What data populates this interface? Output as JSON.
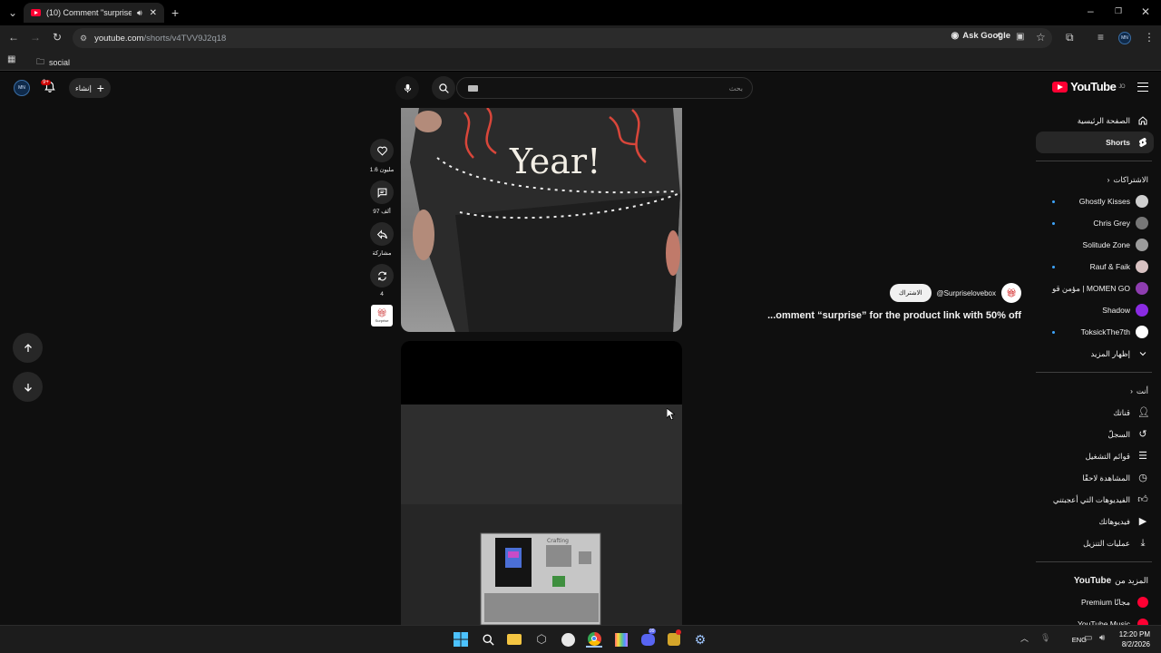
{
  "browser": {
    "tab_title": "(10) Comment \"surprise\" fo",
    "url_host": "youtube.com",
    "url_path": "/shorts/v4TVV9J2q18",
    "ask_google": "Ask Google",
    "bookmark_folder": "social",
    "profile_initials": "MN"
  },
  "masthead": {
    "logo_text": "YouTube",
    "logo_region": "JO",
    "search_placeholder": "بحث",
    "create_label": "إنشاء",
    "notif_count": "9+",
    "avatar_initials": "MN"
  },
  "sidebar": {
    "home": "الصفحة الرئيسية",
    "shorts": "Shorts",
    "subscriptions_header": "الاشتراكات",
    "subscriptions": [
      {
        "name": "Ghostly Kisses",
        "dot": true,
        "color": "#cfcfcf"
      },
      {
        "name": "Chris Grey",
        "dot": true,
        "color": "#777777"
      },
      {
        "name": "Solitude Zone",
        "dot": false,
        "color": "#9b9b9b"
      },
      {
        "name": "Rauf & Faik",
        "dot": true,
        "color": "#d8c2c2"
      },
      {
        "name": "مؤمن قو | MOMEN GO",
        "dot": false,
        "color": "#8e3db0"
      },
      {
        "name": "Shadow",
        "dot": false,
        "color": "#8a2be2"
      },
      {
        "name": "ToksickThe7th",
        "dot": true,
        "color": "#ffffff"
      }
    ],
    "show_more": "إظهار المزيد",
    "you_header": "أنت",
    "you_items": [
      "قناتك",
      "السجلّ",
      "قوائم التشغيل",
      "المشاهدة لاحقًا",
      "الفيديوهات التي أعجبتني",
      "فيديوهاتك",
      "عمليات التنزيل"
    ],
    "more_from_prefix": "المزيد من",
    "more_from_brand": "YouTube",
    "more_items": [
      "Premium مجانًا",
      "YouTube Music"
    ]
  },
  "short": {
    "likes": "1.6 مليون",
    "comments": "97 ألف",
    "share": "مشاركة",
    "remix": "4",
    "channel_handle": "@Surpriselovebox",
    "subscribe": "الاشتراك",
    "title": "...omment “surprise” for the product link with 50% off",
    "box_text": "Year!",
    "crafting_label": "Crafting",
    "channel_thumb_text": "Surprise"
  },
  "taskbar": {
    "lang": "ENG",
    "time": "12:20 PM",
    "date": "8/2/2026",
    "discord_badge": "99"
  }
}
